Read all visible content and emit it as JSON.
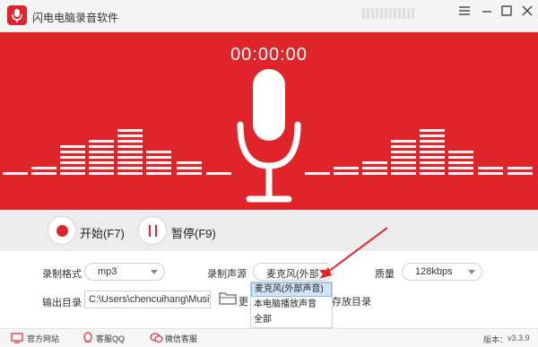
{
  "app": {
    "title": "闪电电脑录音软件"
  },
  "recording": {
    "timer": "00:00:00"
  },
  "controls": {
    "start_label": "开始(F7)",
    "pause_label": "暂停(F9)"
  },
  "settings": {
    "format_label": "录制格式",
    "format_value": "mp3",
    "source_label": "录制声源",
    "source_value": "麦克风(外部",
    "quality_label": "质量",
    "quality_value": "128kbps",
    "output_label": "输出目录",
    "output_value": "C:\\Users\\chencuihang\\Music",
    "folder_text_left": "更",
    "folder_text_right": "存放目录",
    "source_options": [
      "麦克风(外部声音)",
      "本电脑播放声音",
      "全部"
    ],
    "source_selected_index": 0
  },
  "footer": {
    "website": "官方网站",
    "support_qq": "客服QQ",
    "support_wechat": "微信客服",
    "version_label": "版本：",
    "version_value": "v3.3.9"
  },
  "colors": {
    "brand": "#e0252a",
    "strip": "#ececec",
    "selection": "#cfe4f7"
  },
  "icons": [
    "microphone-icon",
    "minimize-icon",
    "menu-icon",
    "maximize-icon",
    "close-icon",
    "folder-icon",
    "website-icon",
    "qq-icon",
    "wechat-icon"
  ]
}
